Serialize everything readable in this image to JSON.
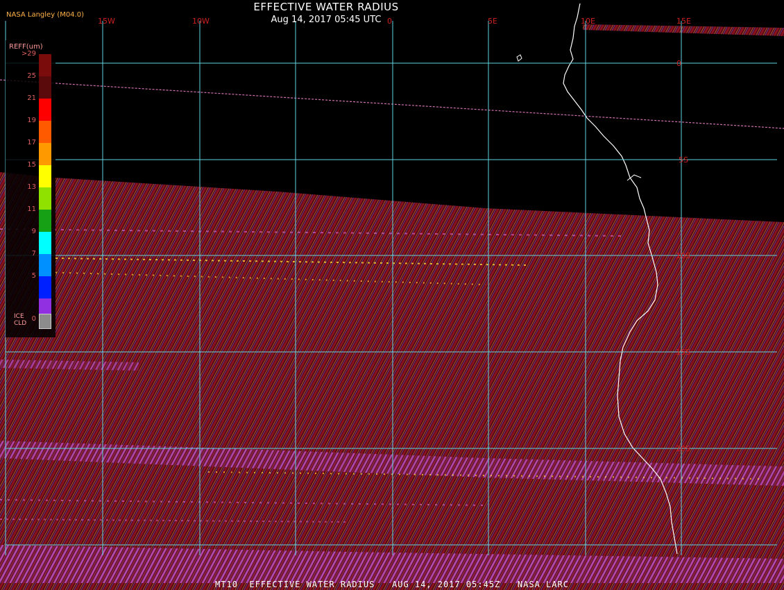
{
  "title": "EFFECTIVE WATER RADIUS",
  "datetime": "Aug 14, 2017 05:45 UTC",
  "credit": "NASA Langley (M04.0)",
  "footer": "MT10  EFFECTIVE WATER RADIUS   AUG 14, 2017 05:45Z   NASA LARC",
  "legend": {
    "title": "REFF(um)",
    "ticks": [
      ">29",
      "25",
      "21",
      "19",
      "17",
      "15",
      "13",
      "11",
      "9",
      "7",
      "5",
      "0"
    ],
    "colors": [
      "#7a0c0c",
      "#5a0a0a",
      "#ff0000",
      "#ff5a00",
      "#ff9900",
      "#ffff00",
      "#90e000",
      "#16a016",
      "#00ffff",
      "#0090ff",
      "#0020ff",
      "#9030e0"
    ],
    "ice_label": "ICE\nCLD",
    "ice_color": "#8c8c8c"
  },
  "map": {
    "lon_labels": [
      "15W",
      "10W",
      "0",
      "5E",
      "10E",
      "15E"
    ],
    "lat_labels": [
      "0",
      "5S",
      "10S",
      "15S",
      "20S"
    ],
    "colors": {
      "grid": "#5fd4e0",
      "coast": "#ffffff",
      "lon_label": "#d02020",
      "lat_label": "#d02020",
      "swath_a": "#6a0a12",
      "swath_b": "#8a1a3a",
      "swath_c": "#b040c0"
    }
  }
}
